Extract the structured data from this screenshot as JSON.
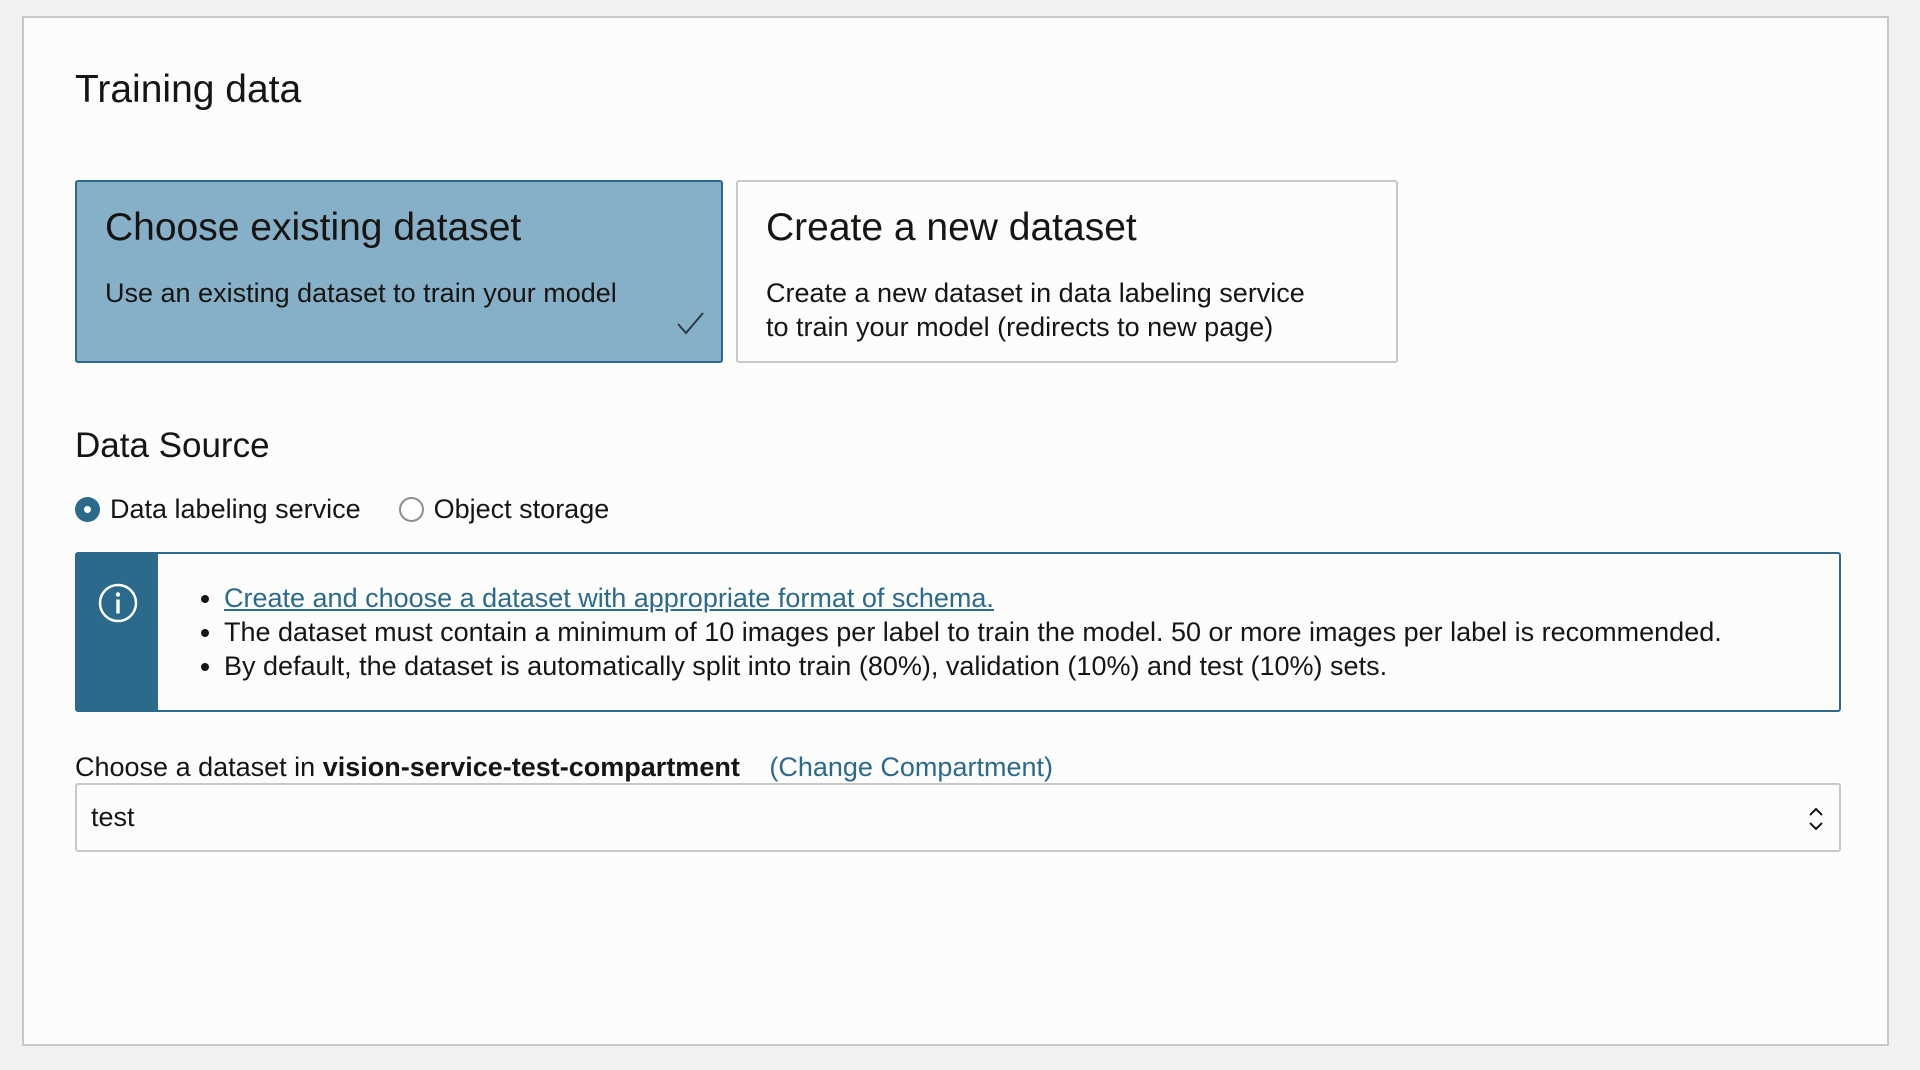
{
  "section": {
    "title": "Training data"
  },
  "cards": {
    "existing": {
      "title": "Choose existing dataset",
      "description": "Use an existing dataset to train your model",
      "selected": true
    },
    "new": {
      "title": "Create a new dataset",
      "description_line1": "Create a new dataset in data labeling service",
      "description_line2": "to train your model (redirects to new page)",
      "selected": false
    }
  },
  "data_source": {
    "title": "Data Source",
    "options": [
      {
        "label": "Data labeling service",
        "checked": true
      },
      {
        "label": "Object storage",
        "checked": false
      }
    ]
  },
  "info": {
    "icon": "info-icon",
    "items": [
      {
        "text": "Create and choose a dataset with appropriate format of schema.",
        "link": true
      },
      {
        "text": "The dataset must contain a minimum of 10 images per label to train the model. 50 or more images per label is recommended.",
        "link": false
      },
      {
        "text": "By default, the dataset is automatically split into train (80%), validation (10%) and test (10%) sets.",
        "link": false
      }
    ]
  },
  "dataset_select": {
    "label_prefix": "Choose a dataset in",
    "compartment": "vision-service-test-compartment",
    "change_link": "(Change Compartment)",
    "value": "test"
  },
  "colors": {
    "accent": "#2c6a8c",
    "selected_card": "#86b0c7",
    "border": "#c9c8c6"
  }
}
